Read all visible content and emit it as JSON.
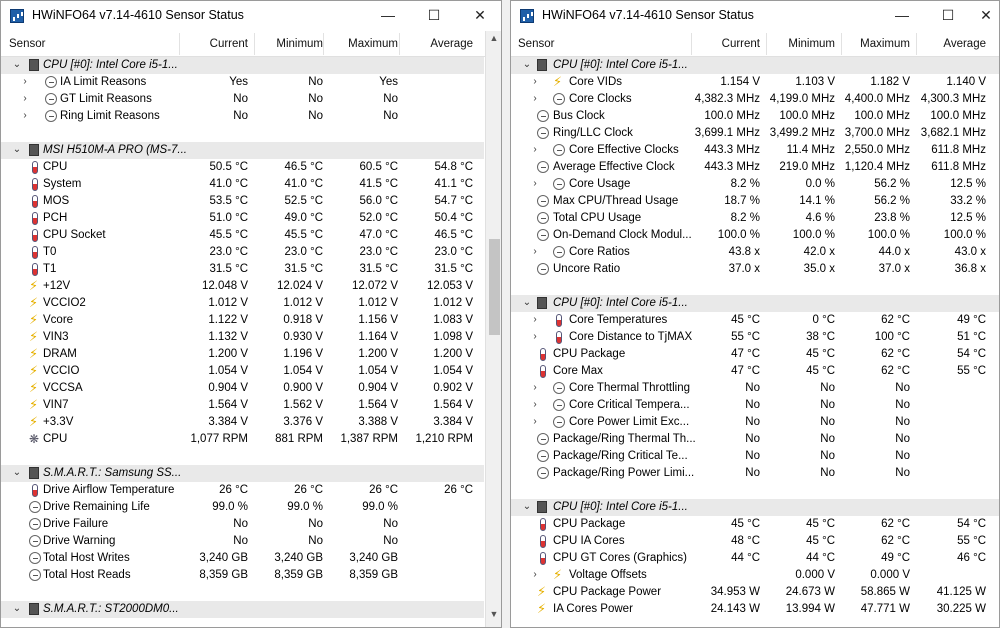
{
  "left": {
    "title": "HWiNFO64 v7.14-4610 Sensor Status",
    "controls": {
      "minimize": "—",
      "maximize": "☐",
      "close": "✕"
    },
    "columns": [
      "Sensor",
      "Current",
      "Minimum",
      "Maximum",
      "Average"
    ],
    "rows": [
      {
        "t": "g",
        "chev": "⌄",
        "icon": "chip",
        "name": "CPU [#0]: Intel Core i5-1..."
      },
      {
        "t": "r",
        "chev": "›",
        "icon": "clock",
        "ind": 1,
        "name": "IA Limit Reasons",
        "v": [
          "Yes",
          "No",
          "Yes",
          ""
        ]
      },
      {
        "t": "r",
        "chev": "›",
        "icon": "clock",
        "ind": 1,
        "name": "GT Limit Reasons",
        "v": [
          "No",
          "No",
          "No",
          ""
        ]
      },
      {
        "t": "r",
        "chev": "›",
        "icon": "clock",
        "ind": 1,
        "name": "Ring Limit Reasons",
        "v": [
          "No",
          "No",
          "No",
          ""
        ]
      },
      {
        "t": "s"
      },
      {
        "t": "g",
        "chev": "⌄",
        "icon": "chip",
        "name": "MSI H510M-A PRO (MS-7..."
      },
      {
        "t": "r",
        "icon": "therm",
        "name": "CPU",
        "v": [
          "50.5 °C",
          "46.5 °C",
          "60.5 °C",
          "54.8 °C"
        ]
      },
      {
        "t": "r",
        "icon": "therm",
        "name": "System",
        "v": [
          "41.0 °C",
          "41.0 °C",
          "41.5 °C",
          "41.1 °C"
        ]
      },
      {
        "t": "r",
        "icon": "therm",
        "name": "MOS",
        "v": [
          "53.5 °C",
          "52.5 °C",
          "56.0 °C",
          "54.7 °C"
        ]
      },
      {
        "t": "r",
        "icon": "therm",
        "name": "PCH",
        "v": [
          "51.0 °C",
          "49.0 °C",
          "52.0 °C",
          "50.4 °C"
        ]
      },
      {
        "t": "r",
        "icon": "therm",
        "name": "CPU Socket",
        "v": [
          "45.5 °C",
          "45.5 °C",
          "47.0 °C",
          "46.5 °C"
        ]
      },
      {
        "t": "r",
        "icon": "therm",
        "name": "T0",
        "v": [
          "23.0 °C",
          "23.0 °C",
          "23.0 °C",
          "23.0 °C"
        ]
      },
      {
        "t": "r",
        "icon": "therm",
        "name": "T1",
        "v": [
          "31.5 °C",
          "31.5 °C",
          "31.5 °C",
          "31.5 °C"
        ]
      },
      {
        "t": "r",
        "icon": "volt",
        "name": "+12V",
        "v": [
          "12.048 V",
          "12.024 V",
          "12.072 V",
          "12.053 V"
        ]
      },
      {
        "t": "r",
        "icon": "volt",
        "name": "VCCIO2",
        "v": [
          "1.012 V",
          "1.012 V",
          "1.012 V",
          "1.012 V"
        ]
      },
      {
        "t": "r",
        "icon": "volt",
        "name": "Vcore",
        "v": [
          "1.122 V",
          "0.918 V",
          "1.156 V",
          "1.083 V"
        ]
      },
      {
        "t": "r",
        "icon": "volt",
        "name": "VIN3",
        "v": [
          "1.132 V",
          "0.930 V",
          "1.164 V",
          "1.098 V"
        ]
      },
      {
        "t": "r",
        "icon": "volt",
        "name": "DRAM",
        "v": [
          "1.200 V",
          "1.196 V",
          "1.200 V",
          "1.200 V"
        ]
      },
      {
        "t": "r",
        "icon": "volt",
        "name": "VCCIO",
        "v": [
          "1.054 V",
          "1.054 V",
          "1.054 V",
          "1.054 V"
        ]
      },
      {
        "t": "r",
        "icon": "volt",
        "name": "VCCSA",
        "v": [
          "0.904 V",
          "0.900 V",
          "0.904 V",
          "0.902 V"
        ]
      },
      {
        "t": "r",
        "icon": "volt",
        "name": "VIN7",
        "v": [
          "1.564 V",
          "1.562 V",
          "1.564 V",
          "1.564 V"
        ]
      },
      {
        "t": "r",
        "icon": "volt",
        "name": "+3.3V",
        "v": [
          "3.384 V",
          "3.376 V",
          "3.388 V",
          "3.384 V"
        ]
      },
      {
        "t": "r",
        "icon": "fan",
        "name": "CPU",
        "v": [
          "1,077 RPM",
          "881 RPM",
          "1,387 RPM",
          "1,210 RPM"
        ]
      },
      {
        "t": "s"
      },
      {
        "t": "g",
        "chev": "⌄",
        "icon": "chip",
        "name": "S.M.A.R.T.: Samsung SS..."
      },
      {
        "t": "r",
        "icon": "therm",
        "name": "Drive Airflow Temperature",
        "v": [
          "26 °C",
          "26 °C",
          "26 °C",
          "26 °C"
        ]
      },
      {
        "t": "r",
        "icon": "clock",
        "name": "Drive Remaining Life",
        "v": [
          "99.0 %",
          "99.0 %",
          "99.0 %",
          ""
        ]
      },
      {
        "t": "r",
        "icon": "clock",
        "name": "Drive Failure",
        "v": [
          "No",
          "No",
          "No",
          ""
        ]
      },
      {
        "t": "r",
        "icon": "clock",
        "name": "Drive Warning",
        "v": [
          "No",
          "No",
          "No",
          ""
        ]
      },
      {
        "t": "r",
        "icon": "clock",
        "name": "Total Host Writes",
        "v": [
          "3,240 GB",
          "3,240 GB",
          "3,240 GB",
          ""
        ]
      },
      {
        "t": "r",
        "icon": "clock",
        "name": "Total Host Reads",
        "v": [
          "8,359 GB",
          "8,359 GB",
          "8,359 GB",
          ""
        ]
      },
      {
        "t": "s"
      },
      {
        "t": "g",
        "chev": "⌄",
        "icon": "chip",
        "name": "S.M.A.R.T.: ST2000DM0..."
      }
    ]
  },
  "right": {
    "title": "HWiNFO64 v7.14-4610 Sensor Status",
    "controls": {
      "minimize": "—",
      "maximize": "☐",
      "close": "✕"
    },
    "columns": [
      "Sensor",
      "Current",
      "Minimum",
      "Maximum",
      "Average"
    ],
    "rows": [
      {
        "t": "g",
        "chev": "⌄",
        "icon": "chip",
        "name": "CPU [#0]: Intel Core i5-1..."
      },
      {
        "t": "r",
        "chev": "›",
        "icon": "volt",
        "ind": 1,
        "name": "Core VIDs",
        "v": [
          "1.154 V",
          "1.103 V",
          "1.182 V",
          "1.140 V"
        ]
      },
      {
        "t": "r",
        "chev": "›",
        "icon": "clock",
        "ind": 1,
        "name": "Core Clocks",
        "v": [
          "4,382.3 MHz",
          "4,199.0 MHz",
          "4,400.0 MHz",
          "4,300.3 MHz"
        ]
      },
      {
        "t": "r",
        "icon": "clock",
        "name": "Bus Clock",
        "v": [
          "100.0 MHz",
          "100.0 MHz",
          "100.0 MHz",
          "100.0 MHz"
        ]
      },
      {
        "t": "r",
        "icon": "clock",
        "name": "Ring/LLC Clock",
        "v": [
          "3,699.1 MHz",
          "3,499.2 MHz",
          "3,700.0 MHz",
          "3,682.1 MHz"
        ]
      },
      {
        "t": "r",
        "chev": "›",
        "icon": "clock",
        "ind": 1,
        "name": "Core Effective Clocks",
        "v": [
          "443.3 MHz",
          "11.4 MHz",
          "2,550.0 MHz",
          "611.8 MHz"
        ]
      },
      {
        "t": "r",
        "icon": "clock",
        "name": "Average Effective Clock",
        "v": [
          "443.3 MHz",
          "219.0 MHz",
          "1,120.4 MHz",
          "611.8 MHz"
        ]
      },
      {
        "t": "r",
        "chev": "›",
        "icon": "clock",
        "ind": 1,
        "name": "Core Usage",
        "v": [
          "8.2 %",
          "0.0 %",
          "56.2 %",
          "12.5 %"
        ]
      },
      {
        "t": "r",
        "icon": "clock",
        "name": "Max CPU/Thread Usage",
        "v": [
          "18.7 %",
          "14.1 %",
          "56.2 %",
          "33.2 %"
        ]
      },
      {
        "t": "r",
        "icon": "clock",
        "name": "Total CPU Usage",
        "v": [
          "8.2 %",
          "4.6 %",
          "23.8 %",
          "12.5 %"
        ]
      },
      {
        "t": "r",
        "icon": "clock",
        "name": "On-Demand Clock Modul...",
        "v": [
          "100.0 %",
          "100.0 %",
          "100.0 %",
          "100.0 %"
        ]
      },
      {
        "t": "r",
        "chev": "›",
        "icon": "clock",
        "ind": 1,
        "name": "Core Ratios",
        "v": [
          "43.8 x",
          "42.0 x",
          "44.0 x",
          "43.0 x"
        ]
      },
      {
        "t": "r",
        "icon": "clock",
        "name": "Uncore Ratio",
        "v": [
          "37.0 x",
          "35.0 x",
          "37.0 x",
          "36.8 x"
        ]
      },
      {
        "t": "s"
      },
      {
        "t": "g",
        "chev": "⌄",
        "icon": "chip",
        "name": "CPU [#0]: Intel Core i5-1..."
      },
      {
        "t": "r",
        "chev": "›",
        "icon": "therm",
        "ind": 1,
        "name": "Core Temperatures",
        "v": [
          "45 °C",
          "0 °C",
          "62 °C",
          "49 °C"
        ]
      },
      {
        "t": "r",
        "chev": "›",
        "icon": "therm",
        "ind": 1,
        "name": "Core Distance to TjMAX",
        "v": [
          "55 °C",
          "38 °C",
          "100 °C",
          "51 °C"
        ]
      },
      {
        "t": "r",
        "icon": "therm",
        "name": "CPU Package",
        "v": [
          "47 °C",
          "45 °C",
          "62 °C",
          "54 °C"
        ]
      },
      {
        "t": "r",
        "icon": "therm",
        "name": "Core Max",
        "v": [
          "47 °C",
          "45 °C",
          "62 °C",
          "55 °C"
        ]
      },
      {
        "t": "r",
        "chev": "›",
        "icon": "clock",
        "ind": 1,
        "name": "Core Thermal Throttling",
        "v": [
          "No",
          "No",
          "No",
          ""
        ]
      },
      {
        "t": "r",
        "chev": "›",
        "icon": "clock",
        "ind": 1,
        "name": "Core Critical Tempera...",
        "v": [
          "No",
          "No",
          "No",
          ""
        ]
      },
      {
        "t": "r",
        "chev": "›",
        "icon": "clock",
        "ind": 1,
        "name": "Core Power Limit Exc...",
        "v": [
          "No",
          "No",
          "No",
          ""
        ]
      },
      {
        "t": "r",
        "icon": "clock",
        "name": "Package/Ring Thermal Th...",
        "v": [
          "No",
          "No",
          "No",
          ""
        ]
      },
      {
        "t": "r",
        "icon": "clock",
        "name": "Package/Ring Critical Te...",
        "v": [
          "No",
          "No",
          "No",
          ""
        ]
      },
      {
        "t": "r",
        "icon": "clock",
        "name": "Package/Ring Power Limi...",
        "v": [
          "No",
          "No",
          "No",
          ""
        ]
      },
      {
        "t": "s"
      },
      {
        "t": "g",
        "chev": "⌄",
        "icon": "chip",
        "name": "CPU [#0]: Intel Core i5-1..."
      },
      {
        "t": "r",
        "icon": "therm",
        "name": "CPU Package",
        "v": [
          "45 °C",
          "45 °C",
          "62 °C",
          "54 °C"
        ]
      },
      {
        "t": "r",
        "icon": "therm",
        "name": "CPU IA Cores",
        "v": [
          "48 °C",
          "45 °C",
          "62 °C",
          "55 °C"
        ]
      },
      {
        "t": "r",
        "icon": "therm",
        "name": "CPU GT Cores (Graphics)",
        "v": [
          "44 °C",
          "44 °C",
          "49 °C",
          "46 °C"
        ]
      },
      {
        "t": "r",
        "chev": "›",
        "icon": "volt",
        "ind": 1,
        "name": "Voltage Offsets",
        "v": [
          "",
          "0.000 V",
          "0.000 V",
          ""
        ]
      },
      {
        "t": "r",
        "icon": "volt",
        "name": "CPU Package Power",
        "v": [
          "34.953 W",
          "24.673 W",
          "58.865 W",
          "41.125 W"
        ]
      },
      {
        "t": "r",
        "icon": "volt",
        "name": "IA Cores Power",
        "v": [
          "24.143 W",
          "13.994 W",
          "47.771 W",
          "30.225 W"
        ]
      }
    ]
  }
}
